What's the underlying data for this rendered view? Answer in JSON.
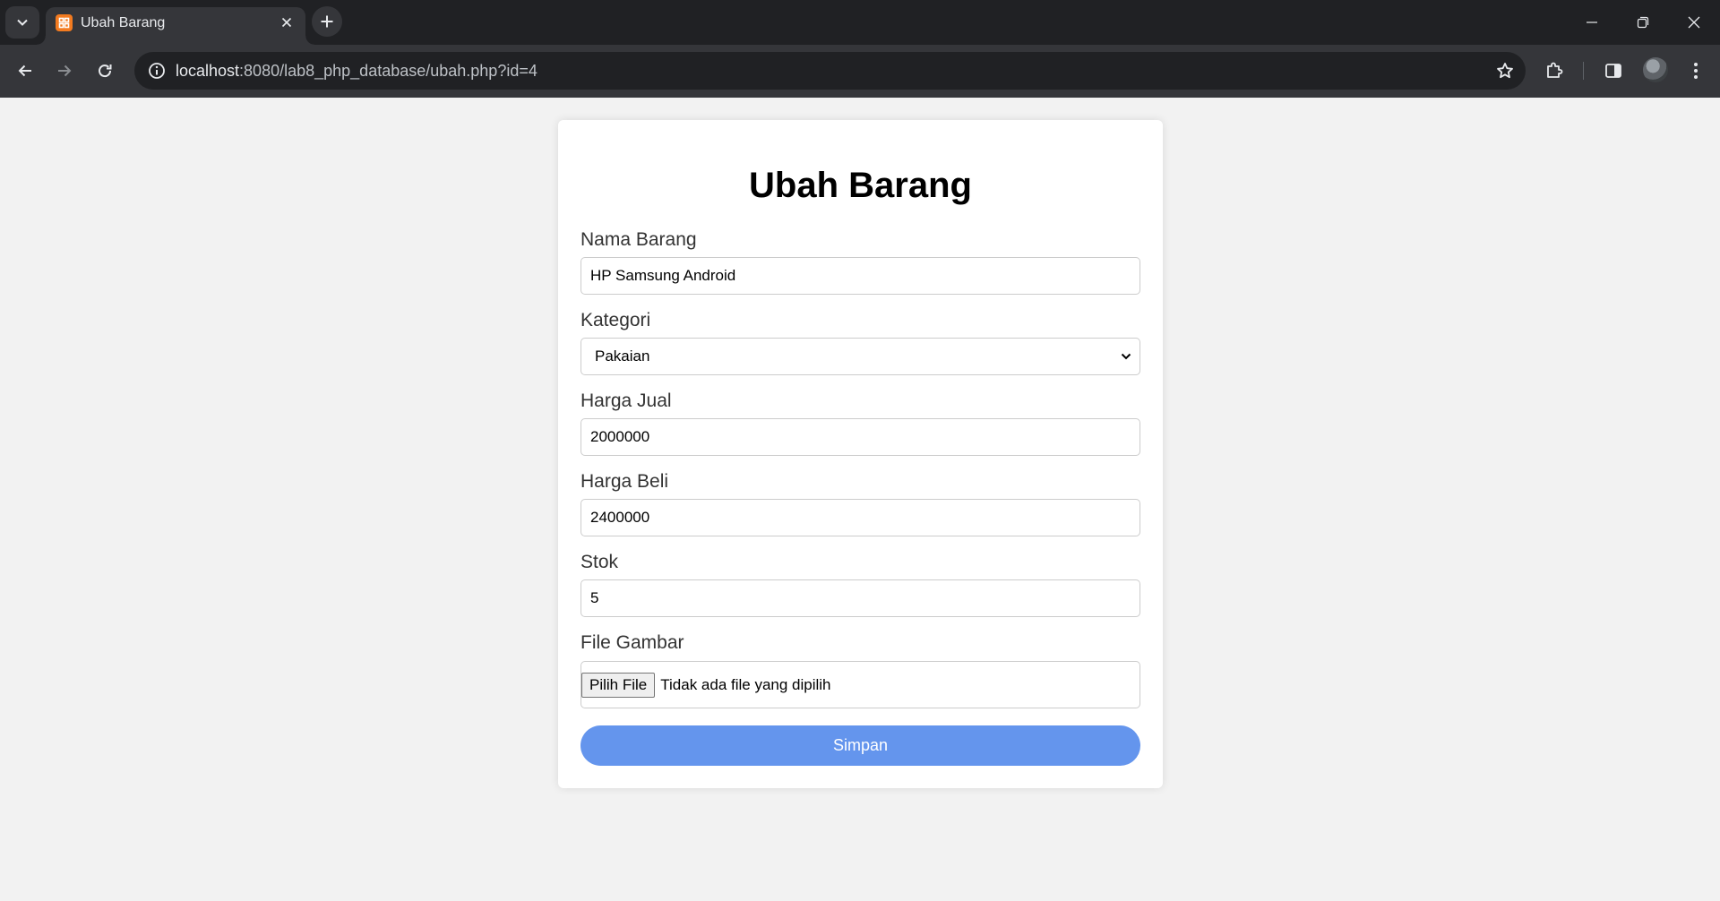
{
  "browser": {
    "tab_title": "Ubah Barang",
    "url_host": "localhost",
    "url_rest": ":8080/lab8_php_database/ubah.php?id=4"
  },
  "form": {
    "title": "Ubah Barang",
    "nama_label": "Nama Barang",
    "nama_value": "HP Samsung Android",
    "kategori_label": "Kategori",
    "kategori_value": "Pakaian",
    "harga_jual_label": "Harga Jual",
    "harga_jual_value": "2000000",
    "harga_beli_label": "Harga Beli",
    "harga_beli_value": "2400000",
    "stok_label": "Stok",
    "stok_value": "5",
    "file_label": "File Gambar",
    "file_button": "Pilih File",
    "file_status": "Tidak ada file yang dipilih",
    "submit_label": "Simpan"
  },
  "colors": {
    "accent": "#6495ed",
    "page_bg": "#f2f2f2",
    "favicon": "#f37b20"
  },
  "icons": [
    "tab-search-icon",
    "xampp-favicon-icon",
    "close-icon",
    "plus-icon",
    "minimize-icon",
    "restore-icon",
    "window-close-icon",
    "back-arrow-icon",
    "forward-arrow-icon",
    "reload-icon",
    "site-info-icon",
    "bookmark-star-icon",
    "extensions-icon",
    "side-panel-icon",
    "profile-avatar",
    "kebab-menu-icon",
    "chevron-down-icon"
  ]
}
